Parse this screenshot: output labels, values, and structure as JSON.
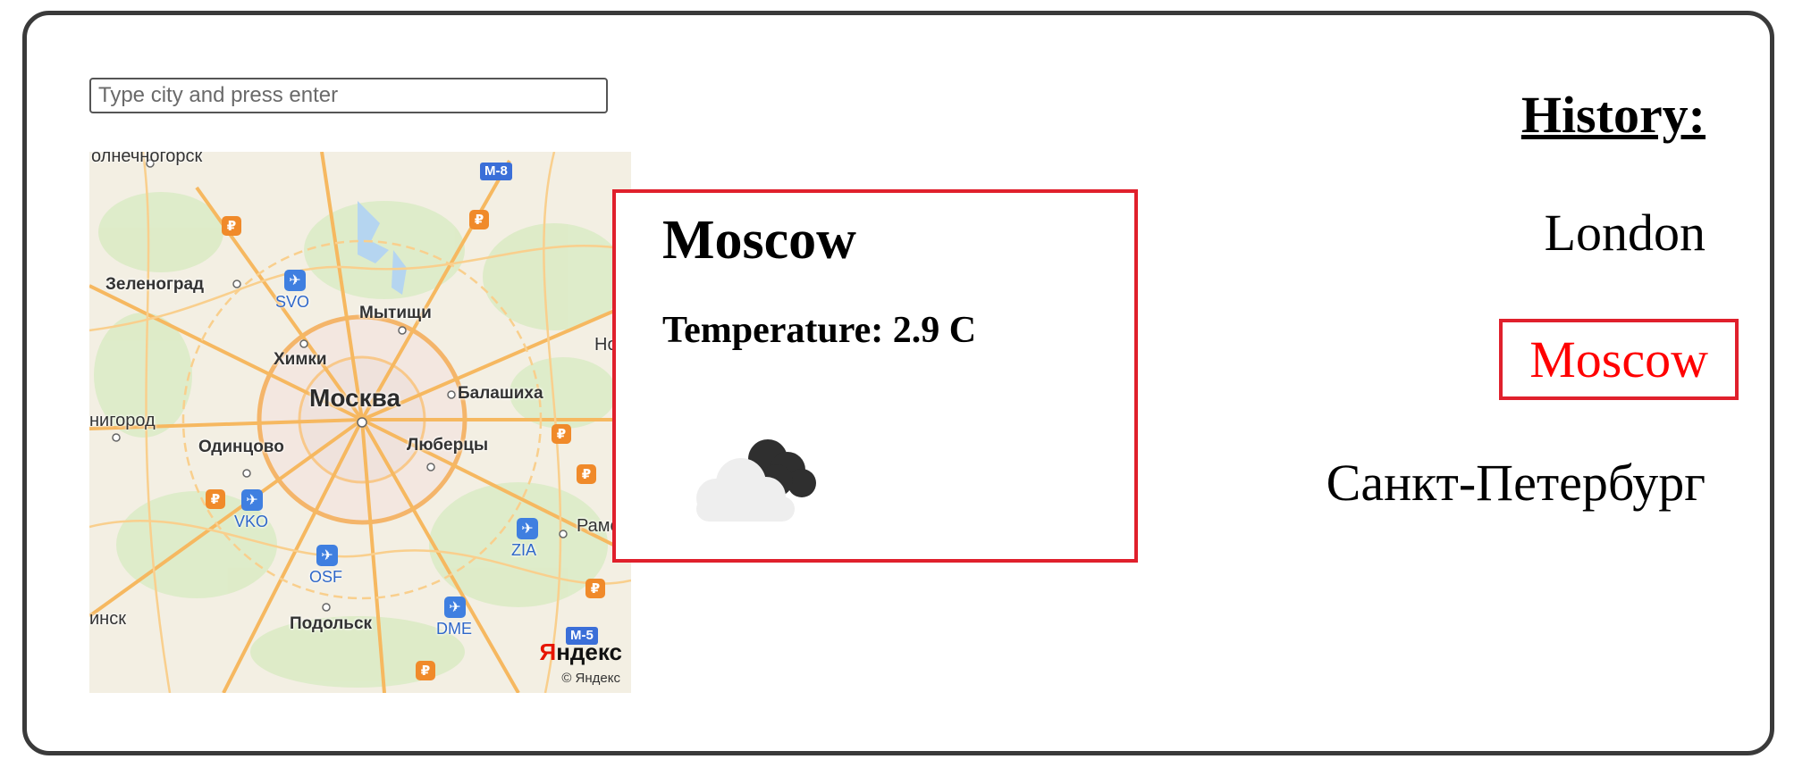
{
  "search": {
    "placeholder": "Type city and press enter",
    "value": ""
  },
  "map": {
    "labels": {
      "solnechnogorsk": "олнечногорск",
      "zelenograd": "Зеленоград",
      "mytishchi": "Мытищи",
      "khimki": "Химки",
      "moskva": "Москва",
      "balashikha": "Балашиха",
      "nogin": "Ног",
      "zvenigorod": "нигород",
      "odintsovo": "Одинцово",
      "lyubertsy": "Люберцы",
      "ramen": "Рамен",
      "minsk": "инск",
      "podolsk": "Подольск"
    },
    "airports": {
      "svo": "SVO",
      "vko": "VKO",
      "zia": "ZIA",
      "osf": "OSF",
      "dme": "DME"
    },
    "highways": {
      "m8": "М-8",
      "m5": "М-5"
    },
    "logo": "Яндекс",
    "logo_first": "Я",
    "logo_rest": "ндекс",
    "copyright": "© Яндекс"
  },
  "weather": {
    "city": "Moscow",
    "temperature_text": "Temperature: 2.9 C",
    "icon": "cloudy-night-icon"
  },
  "history": {
    "title": "History:",
    "items": [
      "London",
      "Moscow",
      "Санкт-Петербург"
    ],
    "active": "Moscow"
  },
  "colors": {
    "accent_border": "#e0202c",
    "active_text": "#ff0000",
    "frame": "#3a3a3a"
  }
}
